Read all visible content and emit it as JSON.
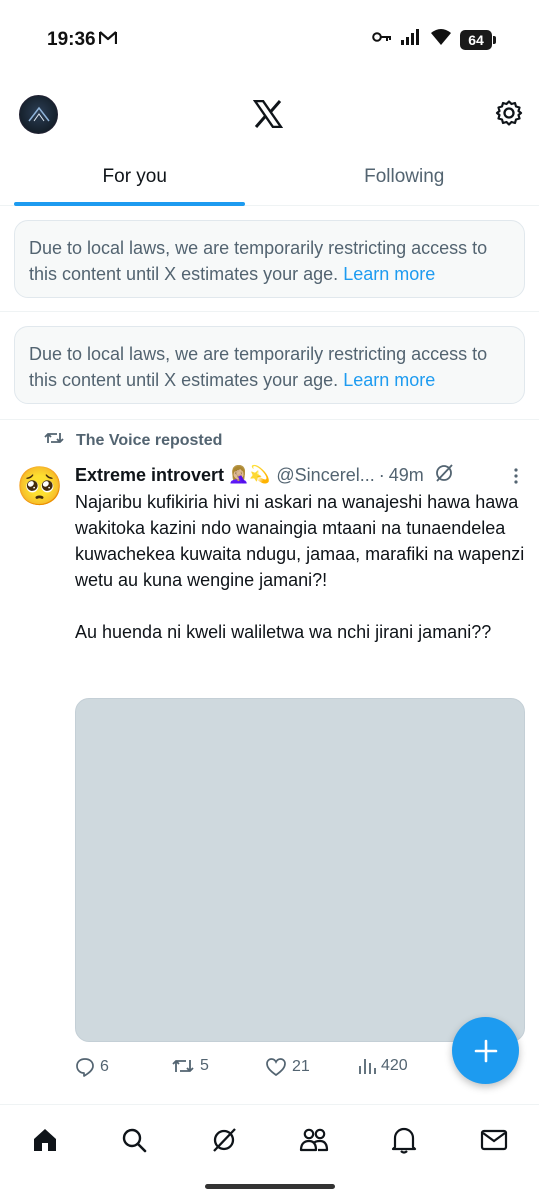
{
  "status_bar": {
    "time": "19:36",
    "battery": "64",
    "icons": [
      "gmail-icon",
      "vpn-key-icon",
      "signal-icon",
      "wifi-icon",
      "battery-icon"
    ]
  },
  "header": {
    "logo": "X",
    "icons": [
      "profile-avatar",
      "x-logo-icon",
      "settings-gear-icon"
    ]
  },
  "tabs": [
    {
      "label": "For you",
      "active": true
    },
    {
      "label": "Following",
      "active": false
    }
  ],
  "notices": [
    {
      "text": "Due to local laws, we are temporarily restricting access to this content until X estimates your age.",
      "link": "Learn more"
    },
    {
      "text": "Due to local laws, we are temporarily restricting access to this content until X estimates your age.",
      "link": "Learn more"
    }
  ],
  "tweet": {
    "repost_label": "The Voice reposted",
    "avatar_emoji": "🥺",
    "author_name": "Extreme introvert",
    "author_emoji": "🤦🏼‍♀️💫",
    "handle": "@Sincerel...",
    "separator": "·",
    "time": "49m",
    "text": "Najaribu kufikiria hivi ni askari na wanajeshi hawa hawa wakitoka kazini ndo wanaingia mtaani na tunaendelea kuwachekea kuwaita ndugu, jamaa, marafiki na wapenzi wetu au kuna wengine jamani?!\n\nAu huenda ni kweli waliletwa wa nchi jirani jamani??",
    "stats": {
      "replies": "6",
      "reposts": "5",
      "likes": "21",
      "views": "420"
    }
  },
  "bottom_nav": [
    "home-icon",
    "search-icon",
    "grok-icon",
    "communities-icon",
    "notifications-icon",
    "messages-icon"
  ],
  "colors": {
    "accent": "#1d9bf0",
    "text_primary": "#0f1419",
    "text_secondary": "#536471",
    "notice_bg": "#f7f9f9",
    "media_placeholder": "#cfd9de"
  }
}
